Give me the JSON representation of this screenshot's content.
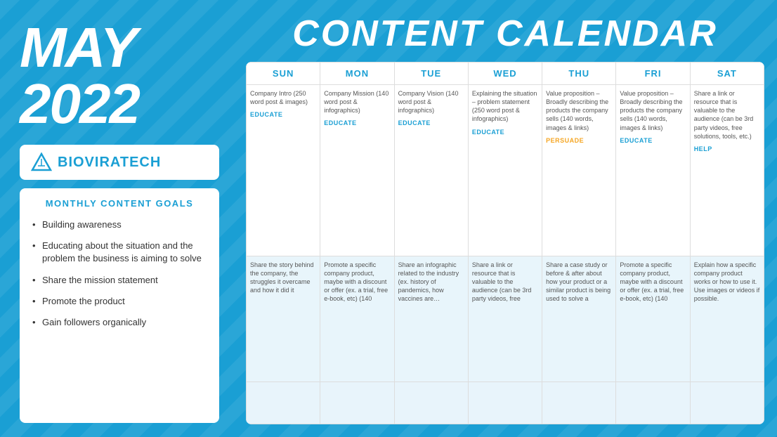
{
  "left": {
    "month": "MAY",
    "year": "2022",
    "logo": {
      "text": "BIOVIRATECH"
    },
    "goals_title": "MONTHLY CONTENT GOALS",
    "goals": [
      "Building awareness",
      "Educating about the situation and the problem the business is aiming to solve",
      "Share the mission statement",
      "Promote the product",
      "Gain followers organically"
    ]
  },
  "right": {
    "calendar_title": "CONTENT CALENDAR",
    "days": [
      "SUN",
      "MON",
      "TUE",
      "WED",
      "THU",
      "FRI",
      "SAT"
    ],
    "week1": [
      {
        "content": "Company Intro (250 word post & images)",
        "tag": "EDUCATE",
        "tag_class": "tag-educate"
      },
      {
        "content": "Company Mission (140 word post & infographics)",
        "tag": "EDUCATE",
        "tag_class": "tag-educate"
      },
      {
        "content": "Company Vision (140 word post & infographics)",
        "tag": "EDUCATE",
        "tag_class": "tag-educate"
      },
      {
        "content": "Explaining the situation – problem statement (250 word post & infographics)",
        "tag": "EDUCATE",
        "tag_class": "tag-educate"
      },
      {
        "content": "Value proposition – Broadly describing the products the company sells (140 words, images & links)",
        "tag": "PERSUADE",
        "tag_class": "tag-persuade"
      },
      {
        "content": "Value proposition – Broadly describing the products the company sells (140 words, images & links)",
        "tag": "EDUCATE",
        "tag_class": "tag-educate"
      },
      {
        "content": "Share a link or resource that is valuable to the audience (can be 3rd party videos, free solutions, tools, etc.)",
        "tag": "HELP",
        "tag_class": "tag-help"
      }
    ],
    "week2": [
      {
        "content": "Share the story behind the company, the struggles it overcame and how it did it",
        "tag": "",
        "tag_class": ""
      },
      {
        "content": "Promote a specific company product, maybe with a discount or offer (ex. a trial, free e-book, etc) (140",
        "tag": "",
        "tag_class": ""
      },
      {
        "content": "Share an infographic related to the industry (ex. history of pandemics, how vaccines are…",
        "tag": "",
        "tag_class": ""
      },
      {
        "content": "Share a link or resource that is valuable to the audience (can be 3rd party videos, free",
        "tag": "",
        "tag_class": ""
      },
      {
        "content": "Share a case study or before & after about how your product or a similar product is being used to solve a",
        "tag": "",
        "tag_class": ""
      },
      {
        "content": "Promote a specific company product, maybe with a discount or offer (ex. a trial, free e-book, etc) (140",
        "tag": "",
        "tag_class": ""
      },
      {
        "content": "Explain how a specific company product works or how to use it. Use images or videos if possible.",
        "tag": "",
        "tag_class": ""
      }
    ]
  }
}
